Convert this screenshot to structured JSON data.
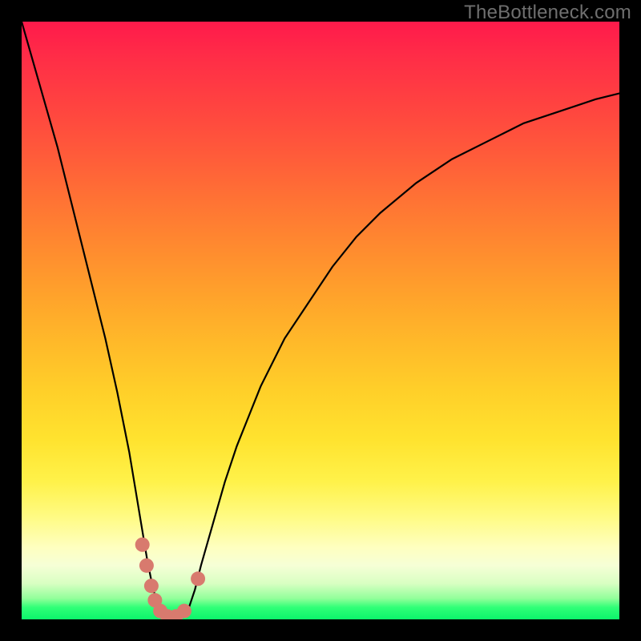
{
  "watermark": "TheBottleneck.com",
  "colors": {
    "frame": "#000000",
    "curve": "#000000",
    "markers": "#d87a6e",
    "gradient_top": "#ff1a4b",
    "gradient_mid": "#ffe32f",
    "gradient_bottom": "#0cf56b",
    "watermark": "#6f6f6f"
  },
  "chart_data": {
    "type": "line",
    "title": "",
    "xlabel": "",
    "ylabel": "",
    "xlim": [
      0,
      100
    ],
    "ylim": [
      0,
      100
    ],
    "background": "vertical-gradient red→yellow→green",
    "x": [
      0,
      2,
      4,
      6,
      8,
      10,
      12,
      14,
      16,
      18,
      19,
      20,
      21,
      22,
      23,
      24,
      25,
      26,
      27,
      28,
      29,
      30,
      32,
      34,
      36,
      38,
      40,
      44,
      48,
      52,
      56,
      60,
      66,
      72,
      78,
      84,
      90,
      96,
      100
    ],
    "y": [
      100,
      93,
      86,
      79,
      71,
      63,
      55,
      47,
      38,
      28,
      22,
      16,
      10,
      5,
      2,
      0.6,
      0.2,
      0.2,
      0.6,
      2,
      5,
      9,
      16,
      23,
      29,
      34,
      39,
      47,
      53,
      59,
      64,
      68,
      73,
      77,
      80,
      83,
      85,
      87,
      88
    ],
    "series": [
      {
        "name": "bottleneck-curve",
        "x_ref": "x",
        "y_ref": "y"
      }
    ],
    "markers": {
      "name": "highlighted-points",
      "points": [
        {
          "x": 20.2,
          "y": 12.5
        },
        {
          "x": 20.9,
          "y": 9.0
        },
        {
          "x": 21.7,
          "y": 5.6
        },
        {
          "x": 22.3,
          "y": 3.2
        },
        {
          "x": 23.2,
          "y": 1.4
        },
        {
          "x": 24.4,
          "y": 0.5
        },
        {
          "x": 25.8,
          "y": 0.5
        },
        {
          "x": 27.2,
          "y": 1.4
        },
        {
          "x": 29.5,
          "y": 6.8
        }
      ],
      "radius_px": 9
    }
  }
}
